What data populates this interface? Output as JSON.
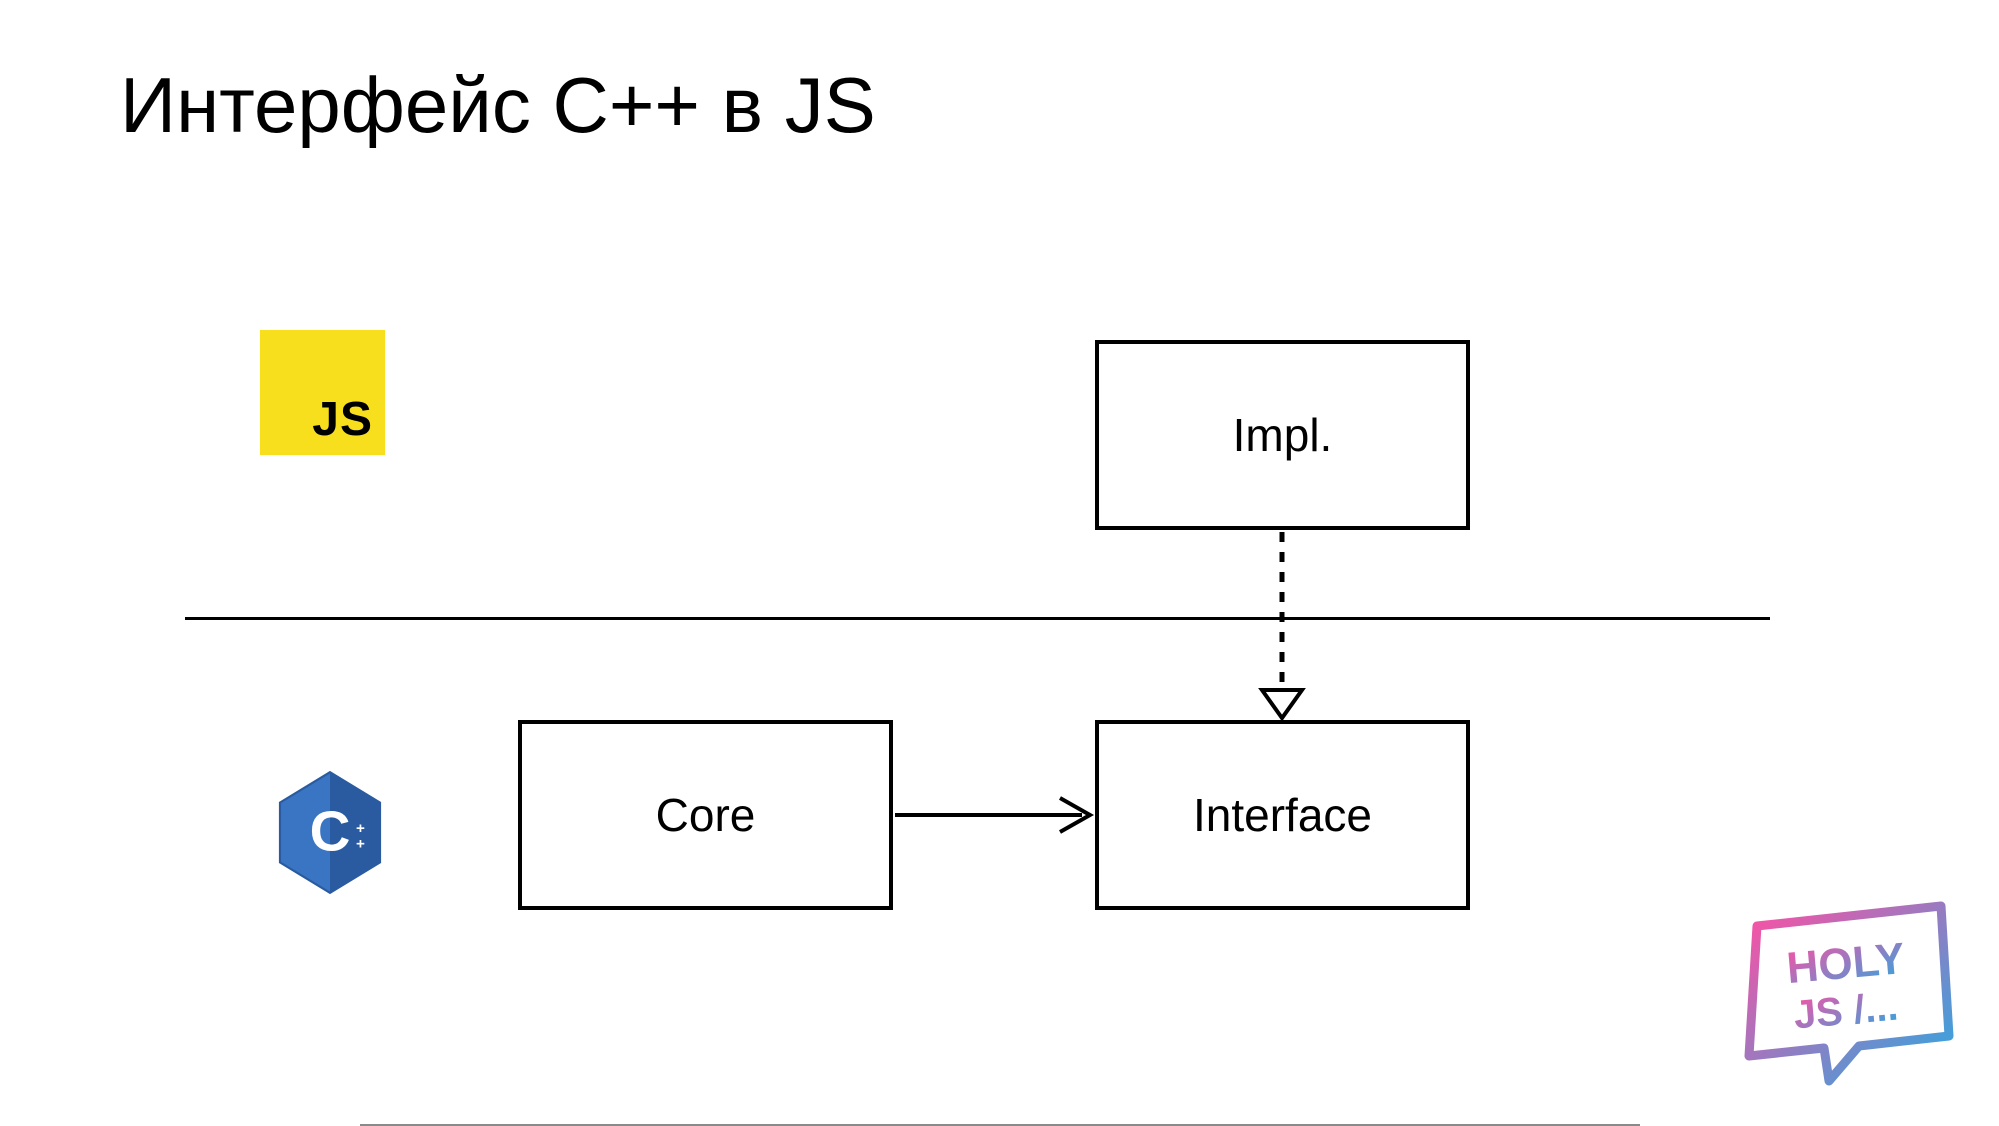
{
  "title": "Интерфейс C++ в JS",
  "badges": {
    "js_label": "JS",
    "cpp_label": "C",
    "cpp_plus": "++"
  },
  "diagram": {
    "nodes": {
      "impl": {
        "label": "Impl.",
        "layer": "js"
      },
      "core": {
        "label": "Core",
        "layer": "cpp"
      },
      "interface": {
        "label": "Interface",
        "layer": "cpp"
      }
    },
    "edges": [
      {
        "from": "core",
        "to": "interface",
        "style": "solid",
        "arrow": "open"
      },
      {
        "from": "impl",
        "to": "interface",
        "style": "dashed",
        "arrow": "hollow-triangle"
      }
    ]
  },
  "conference_logo": {
    "line1": "HOLY",
    "line2": "JS /..."
  }
}
